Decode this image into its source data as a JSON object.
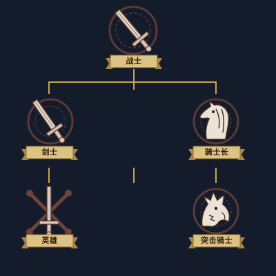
{
  "tree": {
    "root": {
      "label": "战士",
      "icon": "sword-icon"
    },
    "branches": [
      {
        "tier1": {
          "label": "剑士",
          "icon": "sword-icon"
        },
        "tier2": {
          "label": "英雄",
          "icon": "crossed-swords-icon"
        }
      },
      {
        "tier1": {
          "label": "骑士长",
          "icon": "horse-head-icon"
        },
        "tier2": {
          "label": "突击骑士",
          "icon": "dragon-head-icon"
        }
      }
    ]
  },
  "colors": {
    "background": "#141c2c",
    "connector": "#c9a64a",
    "ribbon": "#d9c07a",
    "ribbon_text": "#2a1c10",
    "icon_light": "#e8dcd0",
    "icon_rust": "#7a4a3a"
  }
}
